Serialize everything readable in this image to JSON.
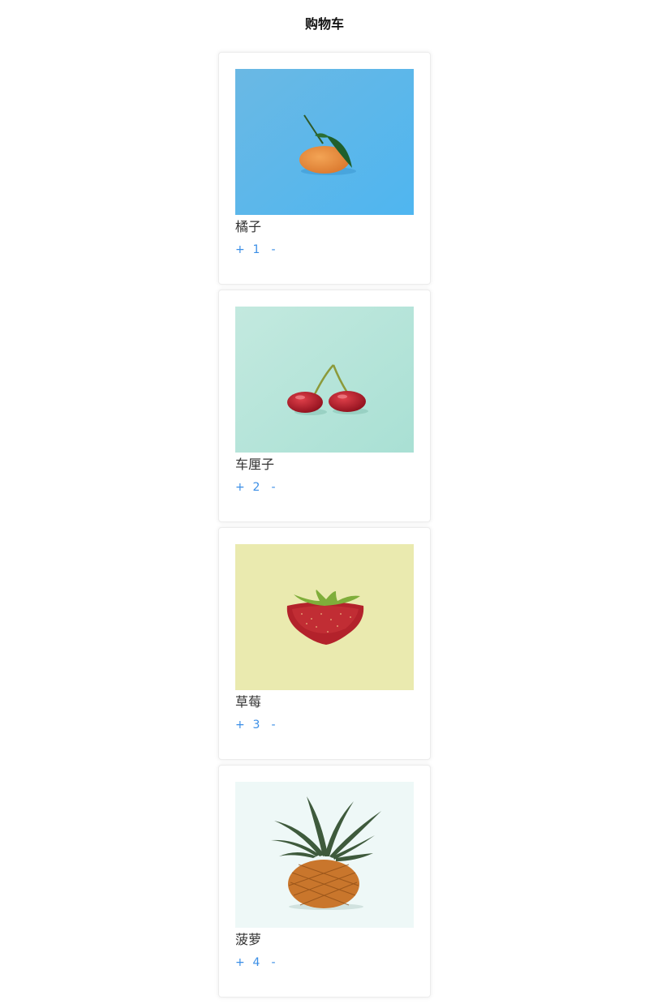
{
  "header": {
    "title": "购物车"
  },
  "cart": {
    "items": [
      {
        "name": "橘子",
        "count": "1",
        "plus": "+",
        "minus": "-",
        "image": "orange",
        "bg": "#5cbcef"
      },
      {
        "name": "车厘子",
        "count": "2",
        "plus": "+",
        "minus": "-",
        "image": "cherries",
        "bg": "#b7e6da"
      },
      {
        "name": "草莓",
        "count": "3",
        "plus": "+",
        "minus": "-",
        "image": "strawberry",
        "bg": "#eaeaaf"
      },
      {
        "name": "菠萝",
        "count": "4",
        "plus": "+",
        "minus": "-",
        "image": "pineapple",
        "bg": "#eef8f7"
      }
    ]
  },
  "colors": {
    "accent": "#3a8ee6",
    "text": "#333333"
  }
}
